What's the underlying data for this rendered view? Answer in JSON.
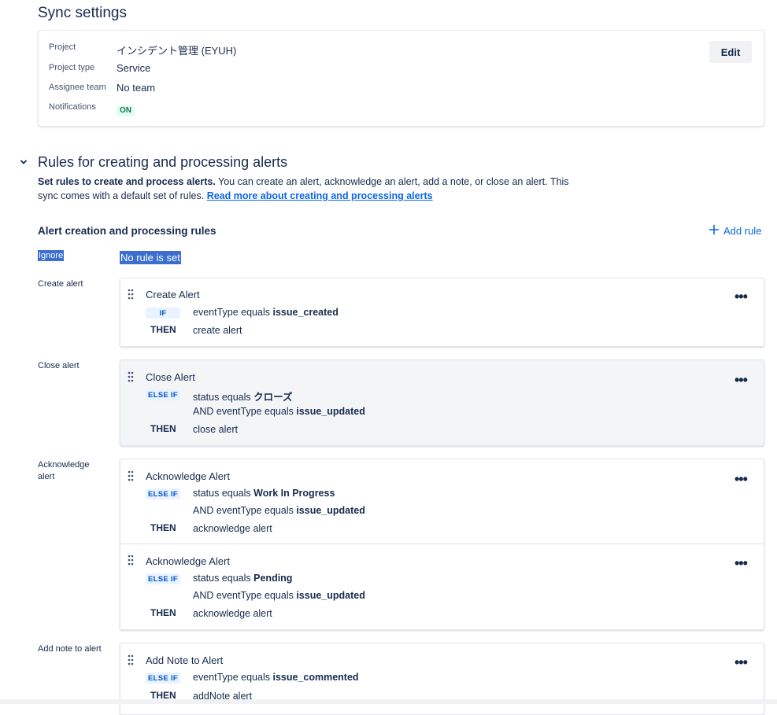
{
  "sync": {
    "title": "Sync settings",
    "fields": [
      {
        "label": "Project",
        "value": "インシデント管理 (EYUH)"
      },
      {
        "label": "Project type",
        "value": "Service"
      },
      {
        "label": "Assignee team",
        "value": "No team"
      },
      {
        "label": "Notifications",
        "value": "ON"
      }
    ],
    "edit_label": "Edit"
  },
  "rules_section": {
    "title": "Rules for creating and processing alerts",
    "desc_bold": "Set rules to create and process alerts.",
    "desc_text": " You can create an alert, acknowledge an alert, add a note, or close an alert. This sync comes with a default set of rules. ",
    "desc_link": "Read more about creating and processing alerts",
    "subheading": "Alert creation and processing rules",
    "add_rule_label": "Add rule",
    "ignore_label": "Ignore",
    "ignore_value": "No rule is set"
  },
  "categories": {
    "create": "Create alert",
    "close": "Close alert",
    "ack": "Acknowledge alert",
    "note": "Add note to alert"
  },
  "rules": [
    {
      "title": "Create Alert",
      "keyword": "IF",
      "conds": [
        {
          "prefix": "eventType equals ",
          "value": "issue_created"
        }
      ],
      "then": "THEN",
      "action": "create alert"
    },
    {
      "title": "Close Alert",
      "keyword": "ELSE IF",
      "conds": [
        {
          "prefix": "status equals ",
          "value": "クローズ"
        },
        {
          "prefix": "AND eventType equals ",
          "value": "issue_updated"
        }
      ],
      "then": "THEN",
      "action": "close alert"
    },
    {
      "title": "Acknowledge Alert",
      "keyword": "ELSE IF",
      "conds": [
        {
          "prefix": "status equals ",
          "value": "Work In Progress"
        },
        {
          "prefix": "AND eventType equals ",
          "value": "issue_updated"
        }
      ],
      "then": "THEN",
      "action": "acknowledge alert"
    },
    {
      "title": "Acknowledge Alert",
      "keyword": "ELSE IF",
      "conds": [
        {
          "prefix": "status equals ",
          "value": "Pending"
        },
        {
          "prefix": "AND eventType equals ",
          "value": "issue_updated"
        }
      ],
      "then": "THEN",
      "action": "acknowledge alert"
    },
    {
      "title": "Add Note to Alert",
      "keyword": "ELSE IF",
      "conds": [
        {
          "prefix": "eventType equals ",
          "value": "issue_commented"
        }
      ],
      "then": "THEN",
      "action": "addNote alert"
    }
  ],
  "icons": {
    "chevron": "chevron-down-icon",
    "add": "plus-icon",
    "drag": "drag-handle-icon",
    "more": "more-icon"
  },
  "colors": {
    "link": "#0c66e4",
    "on_bg": "#dcfff1",
    "on_fg": "#216e4e",
    "lozenge_bg": "#e9f2ff",
    "lozenge_fg": "#0055cc",
    "selection": "#3b6ecf"
  }
}
